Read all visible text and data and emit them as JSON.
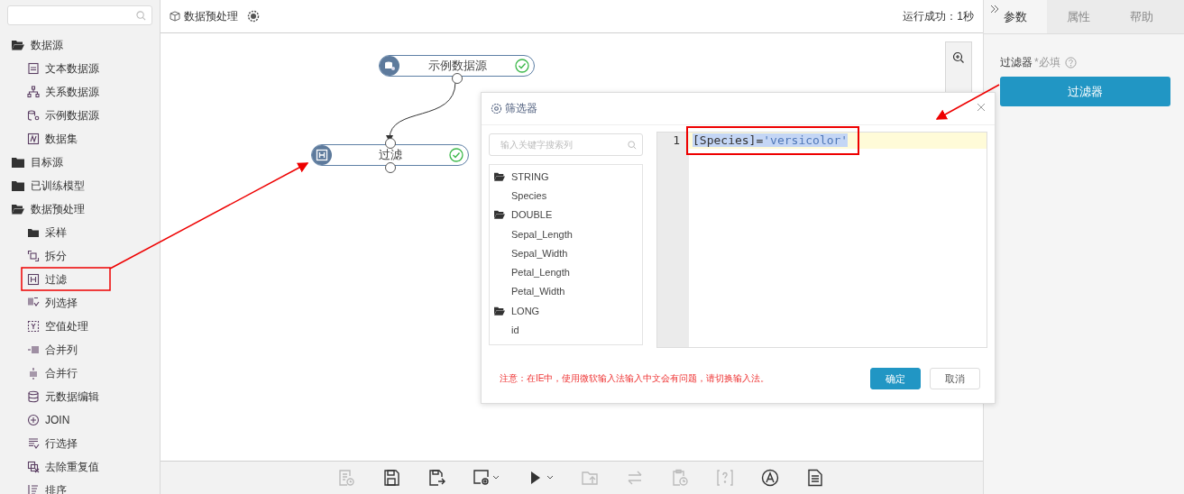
{
  "sidebar": {
    "items": [
      {
        "label": "数据源",
        "expanded": true,
        "children": [
          {
            "label": "文本数据源",
            "kind": "text-source"
          },
          {
            "label": "关系数据源",
            "kind": "relation"
          },
          {
            "label": "示例数据源",
            "kind": "sample-db"
          },
          {
            "label": "数据集",
            "kind": "dataset"
          }
        ]
      },
      {
        "label": "目标源",
        "expanded": false
      },
      {
        "label": "已训练模型",
        "expanded": false
      },
      {
        "label": "数据预处理",
        "expanded": true,
        "children": [
          {
            "label": "采样",
            "kind": "folder"
          },
          {
            "label": "拆分",
            "kind": "split"
          },
          {
            "label": "过滤",
            "kind": "filter"
          },
          {
            "label": "列选择",
            "kind": "columns"
          },
          {
            "label": "空值处理",
            "kind": "null"
          },
          {
            "label": "合并列",
            "kind": "merge-col"
          },
          {
            "label": "合并行",
            "kind": "merge-row"
          },
          {
            "label": "元数据编辑",
            "kind": "db"
          },
          {
            "label": "JOIN",
            "kind": "join"
          },
          {
            "label": "行选择",
            "kind": "rows"
          },
          {
            "label": "去除重复值",
            "kind": "dedupe"
          },
          {
            "label": "排序",
            "kind": "sort"
          }
        ]
      }
    ]
  },
  "canvas": {
    "title": "数据预处理",
    "status": "运行成功：1秒",
    "nodes": [
      {
        "label": "示例数据源",
        "kind": "sample-db",
        "done": true
      },
      {
        "label": "过滤",
        "kind": "filter",
        "done": true
      }
    ]
  },
  "dialog": {
    "title": "筛选器",
    "search": {
      "placeholder": "输入关键字搜索列"
    },
    "fields": [
      {
        "label": "STRING",
        "children": [
          {
            "label": "Species"
          }
        ]
      },
      {
        "label": "DOUBLE",
        "children": [
          {
            "label": "Sepal_Length"
          },
          {
            "label": "Sepal_Width"
          },
          {
            "label": "Petal_Length"
          },
          {
            "label": "Petal_Width"
          }
        ]
      },
      {
        "label": "LONG",
        "children": [
          {
            "label": "id"
          }
        ]
      }
    ],
    "editor": {
      "line_number": "1",
      "tokens": [
        {
          "text": "[Species]=",
          "kind": "plain"
        },
        {
          "text": "'versicolor'",
          "kind": "string"
        }
      ],
      "selected": true
    },
    "note": "注意：在IE中，使用微软输入法输入中文会有问题，请切换输入法。",
    "buttons": [
      {
        "label": "确定",
        "kind": "primary"
      },
      {
        "label": "取消",
        "kind": "default"
      }
    ]
  },
  "toolbar": [
    {
      "kind": "report",
      "disabled": true,
      "dropdown": false
    },
    {
      "kind": "save",
      "disabled": false,
      "dropdown": false
    },
    {
      "kind": "save-as",
      "disabled": false,
      "dropdown": false
    },
    {
      "kind": "settings",
      "disabled": false,
      "dropdown": true
    },
    {
      "kind": "run",
      "disabled": false,
      "dropdown": true
    },
    {
      "kind": "upload",
      "disabled": true,
      "dropdown": false
    },
    {
      "kind": "swap",
      "disabled": true,
      "dropdown": false
    },
    {
      "kind": "schedule",
      "disabled": true,
      "dropdown": false
    },
    {
      "kind": "help",
      "disabled": true,
      "dropdown": false
    },
    {
      "kind": "a-circle",
      "disabled": false,
      "dropdown": false
    },
    {
      "kind": "document",
      "disabled": false,
      "dropdown": false
    }
  ],
  "panel": {
    "tabs": [
      {
        "label": "参数",
        "selected": true
      },
      {
        "label": "属性",
        "selected": false
      },
      {
        "label": "帮助",
        "selected": false
      }
    ],
    "field_label": "过滤器",
    "required": "*必填",
    "button": "过滤器"
  }
}
